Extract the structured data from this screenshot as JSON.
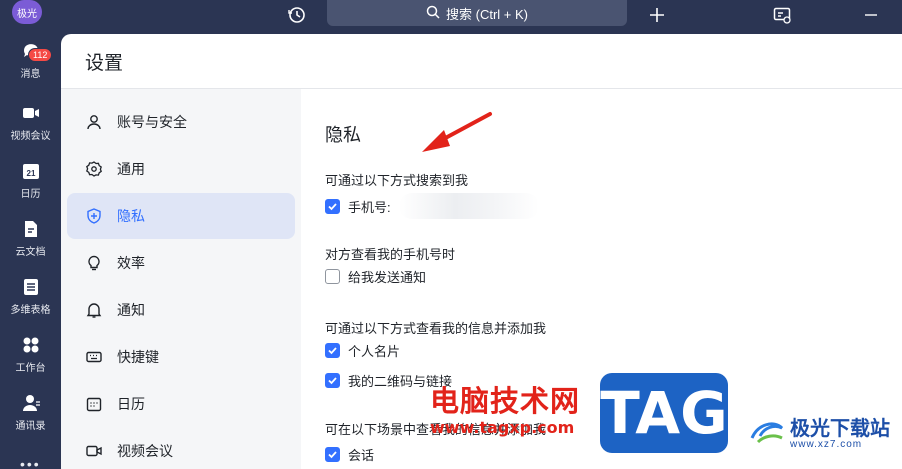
{
  "topbar": {
    "avatar_text": "极光",
    "search_label": "搜索 (Ctrl + K)"
  },
  "rail": {
    "items": [
      {
        "label": "消息",
        "badge": "112",
        "icon": "chat-icon"
      },
      {
        "label": "视频会议",
        "icon": "video-icon"
      },
      {
        "label": "日历",
        "day": "21",
        "icon": "calendar-icon"
      },
      {
        "label": "云文档",
        "icon": "doc-icon"
      },
      {
        "label": "多维表格",
        "icon": "table-icon"
      },
      {
        "label": "工作台",
        "icon": "grid-icon"
      },
      {
        "label": "通讯录",
        "icon": "contacts-icon"
      }
    ],
    "more": "•••"
  },
  "panel": {
    "title": "设置"
  },
  "nav": {
    "items": [
      {
        "label": "账号与安全",
        "icon": "user-icon"
      },
      {
        "label": "通用",
        "icon": "gear-icon"
      },
      {
        "label": "隐私",
        "icon": "shield-icon",
        "active": true
      },
      {
        "label": "效率",
        "icon": "bulb-icon"
      },
      {
        "label": "通知",
        "icon": "bell-icon"
      },
      {
        "label": "快捷键",
        "icon": "keyboard-icon"
      },
      {
        "label": "日历",
        "icon": "calendar-icon"
      },
      {
        "label": "视频会议",
        "icon": "video-icon"
      }
    ]
  },
  "privacy": {
    "title": "隐私",
    "search_label": "可通过以下方式搜索到我",
    "phone_option": "手机号:",
    "phone_checked": true,
    "view_phone_label": "对方查看我的手机号时",
    "notify_option": "给我发送通知",
    "notify_checked": false,
    "add_label": "可通过以下方式查看我的信息并添加我",
    "card_option": "个人名片",
    "card_checked": true,
    "qr_option": "我的二维码与链接",
    "qr_checked": true,
    "scene_label": "可在以下场景中查看我的信息并添加我",
    "chat_option": "会话",
    "chat_checked": true
  },
  "watermark": {
    "cn": "电脑技术网",
    "url": "www.tagxp.com",
    "tag": "TAG",
    "jg_name": "极光下载站",
    "jg_url": "www.xz7.com"
  },
  "colors": {
    "rail_bg": "#2b3553",
    "accent": "#3370ff",
    "active_nav": "#dfe5f6",
    "arrow": "#e2231a"
  }
}
